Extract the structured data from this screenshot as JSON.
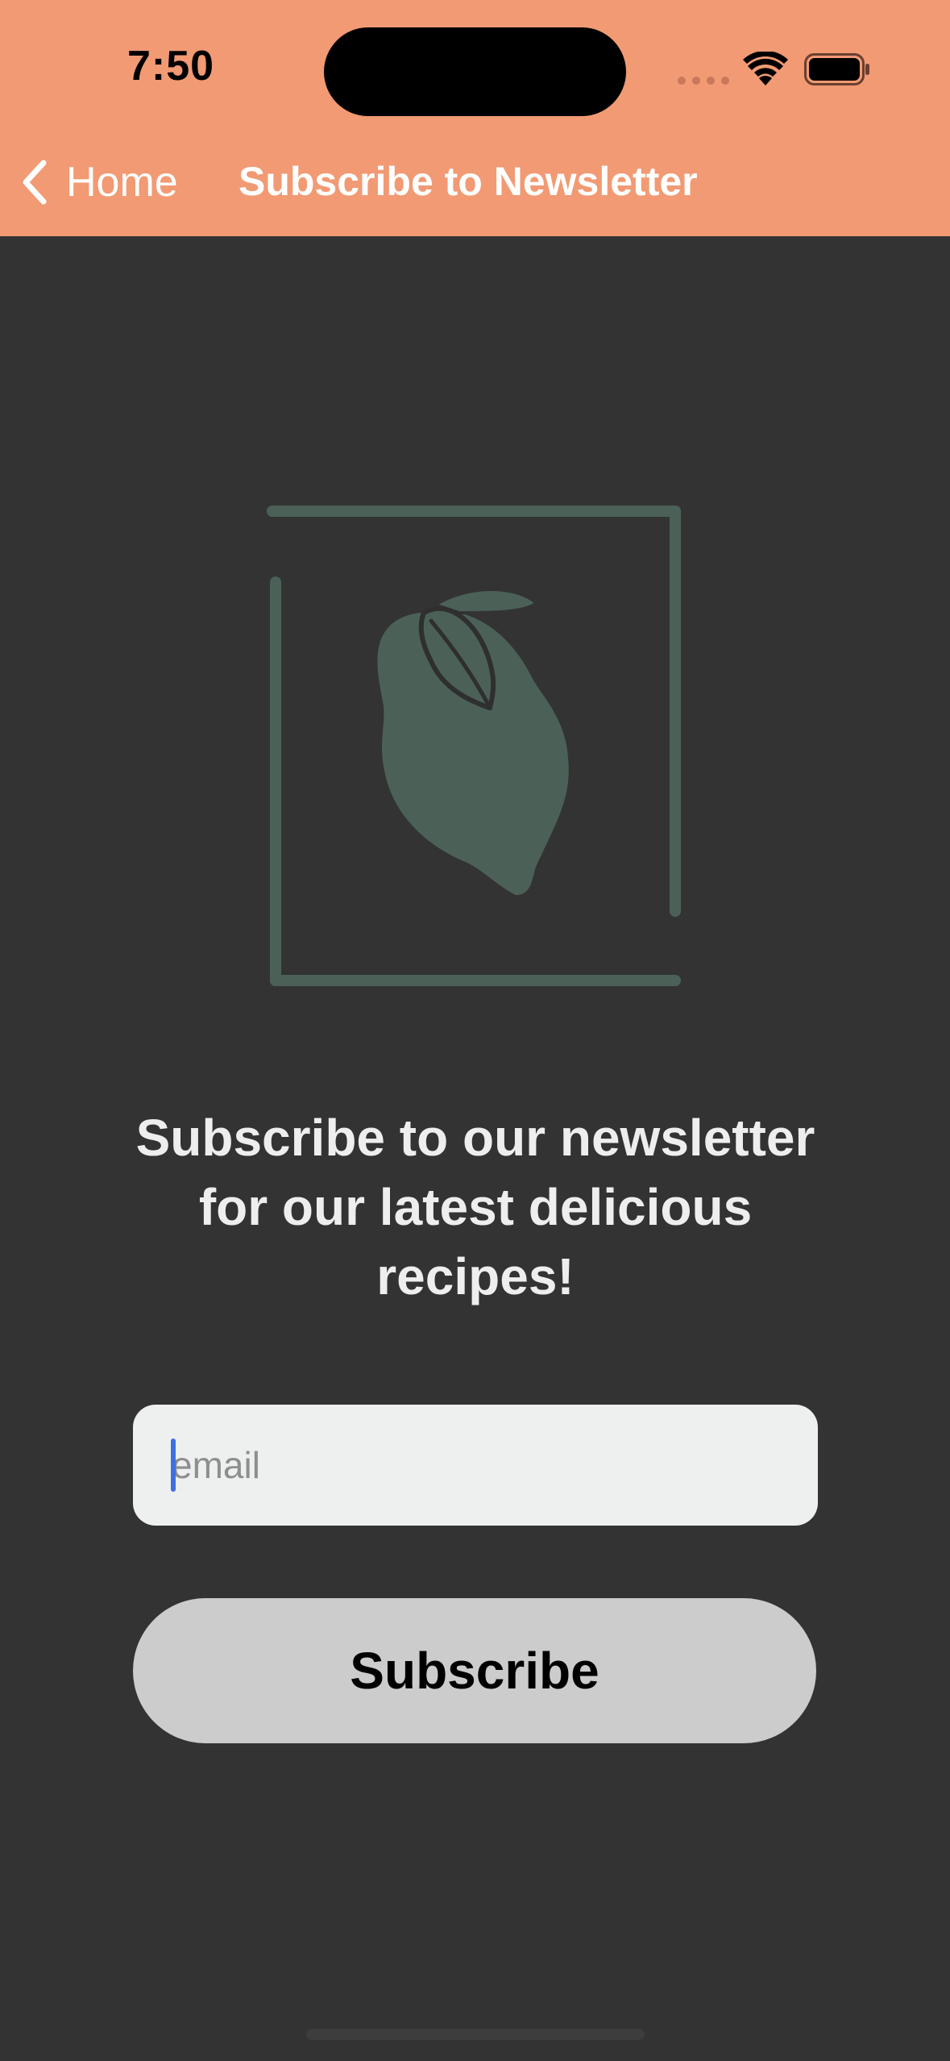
{
  "status_bar": {
    "time": "7:50"
  },
  "nav": {
    "back_label": "Home",
    "title": "Subscribe to Newsletter"
  },
  "main": {
    "heading": "Subscribe to our newsletter\nfor our latest delicious\nrecipes!",
    "email": {
      "value": "",
      "placeholder": "email"
    },
    "subscribe_label": "Subscribe"
  },
  "icons": {
    "back": "chevron-left-icon",
    "illustration": "lemon-illustration-icon",
    "signal": "signal-icon",
    "wifi": "wifi-icon",
    "battery": "battery-icon"
  },
  "colors": {
    "header_bg": "#F19A74",
    "page_bg": "#333333",
    "illustration": "#4B6158",
    "field_bg": "#EEF0F0",
    "button_bg": "#CCCCCC",
    "caret": "#3F6FE0"
  }
}
